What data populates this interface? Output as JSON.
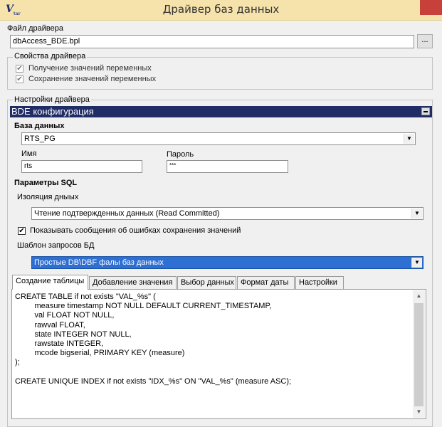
{
  "window": {
    "title": "Драйвер баз данных",
    "close_glyph": "✕"
  },
  "driver_file": {
    "label": "Файл драйвера",
    "value": "dbAccess_BDE.bpl",
    "browse_label": "..."
  },
  "driver_properties": {
    "label": "Свойства драйвера",
    "options": [
      {
        "label": "Получение значений переменных",
        "checked": true
      },
      {
        "label": "Сохранение значений переменных",
        "checked": true
      }
    ]
  },
  "driver_settings": {
    "label": "Настройки драйвера",
    "header": "BDE конфигурация",
    "database": {
      "label": "База данных",
      "value": "RTS_PG"
    },
    "username": {
      "label": "Имя",
      "value": "rts"
    },
    "password": {
      "label": "Пароль",
      "value": "***"
    },
    "sql_params": {
      "label": "Параметры SQL",
      "isolation": {
        "label": "Изоляция дныых",
        "value": "Чтение подтвержденных данных (Read Committed)"
      },
      "show_errors": {
        "label": "Показывать сообщения об ошибках сохранения значений",
        "checked": true
      },
      "template": {
        "label": "Шаблон запросов БД",
        "value": "Простые DB\\DBF фалы баз данных"
      }
    },
    "tabs": [
      {
        "label": "Создание таблицы",
        "active": true
      },
      {
        "label": "Добавление значения",
        "active": false
      },
      {
        "label": "Выбор данных",
        "active": false
      },
      {
        "label": "Формат даты",
        "active": false
      },
      {
        "label": "Настройки",
        "active": false
      }
    ],
    "editor_text": "CREATE TABLE if not exists \"VAL_%s\" (\n\t measure timestamp NOT NULL DEFAULT CURRENT_TIMESTAMP,\n\t val FLOAT NOT NULL,\n\t rawval FLOAT,\n\t state INTEGER NOT NULL,\n\t rawstate INTEGER,\n\t mcode bigserial, PRIMARY KEY (measure)\n);\n\nCREATE UNIQUE INDEX if not exists \"IDX_%s\" ON \"VAL_%s\" (measure ASC);"
  },
  "icons": {
    "check_glyph": "✔",
    "dropdown_glyph": "▼",
    "scroll_up_glyph": "▲",
    "scroll_down_glyph": "▼"
  },
  "colors": {
    "title_bar": "#f6e3ac",
    "close_button": "#c7403a",
    "config_header": "#1f2c66",
    "selection": "#2d6fd2"
  }
}
